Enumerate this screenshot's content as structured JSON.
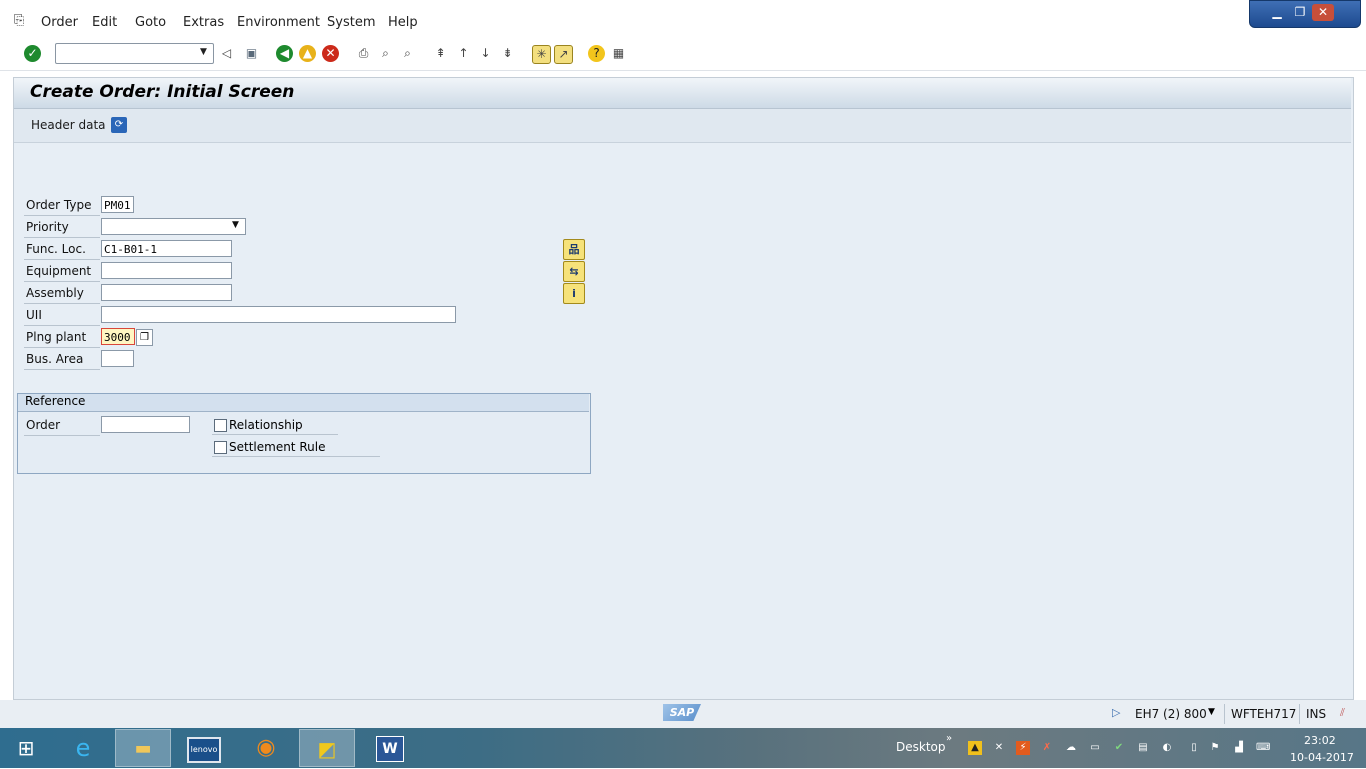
{
  "menu": {
    "items": [
      "Order",
      "Edit",
      "Goto",
      "Extras",
      "Environment",
      "System",
      "Help"
    ]
  },
  "window_controls": {
    "minimize": "▁",
    "restore": "❐",
    "close": "✕"
  },
  "toolbar": {
    "command_value": "",
    "icons": [
      "enter-icon",
      "back-small-icon",
      "save-icon",
      "back-icon",
      "exit-icon",
      "cancel-icon",
      "print-icon",
      "find-icon",
      "find-next-icon",
      "first-page-icon",
      "prev-page-icon",
      "next-page-icon",
      "last-page-icon",
      "new-session-icon",
      "shortcut-icon",
      "help-icon",
      "layout-icon"
    ]
  },
  "page": {
    "title": "Create Order: Initial Screen",
    "header_data_label": "Header data"
  },
  "form": {
    "order_type": {
      "label": "Order Type",
      "value": "PM01"
    },
    "priority": {
      "label": "Priority",
      "value": ""
    },
    "func_loc": {
      "label": "Func. Loc.",
      "value": "C1-B01-1"
    },
    "equipment": {
      "label": "Equipment",
      "value": ""
    },
    "assembly": {
      "label": "Assembly",
      "value": ""
    },
    "uii": {
      "label": "UII",
      "value": ""
    },
    "plng_plant": {
      "label": "Plng plant",
      "value": "3000"
    },
    "bus_area": {
      "label": "Bus. Area",
      "value": ""
    }
  },
  "reference": {
    "title": "Reference",
    "order_label": "Order",
    "order_value": "",
    "relationship_label": "Relationship",
    "relationship_checked": false,
    "settlement_label": "Settlement Rule",
    "settlement_checked": false
  },
  "status": {
    "logo": "SAP",
    "system": "EH7 (2) 800",
    "server": "WFTEH717",
    "mode": "INS"
  },
  "taskbar": {
    "desktop_label": "Desktop",
    "time": "23:02",
    "date": "10-04-2017",
    "lenovo_label": "lenovo",
    "word_label": "W"
  }
}
